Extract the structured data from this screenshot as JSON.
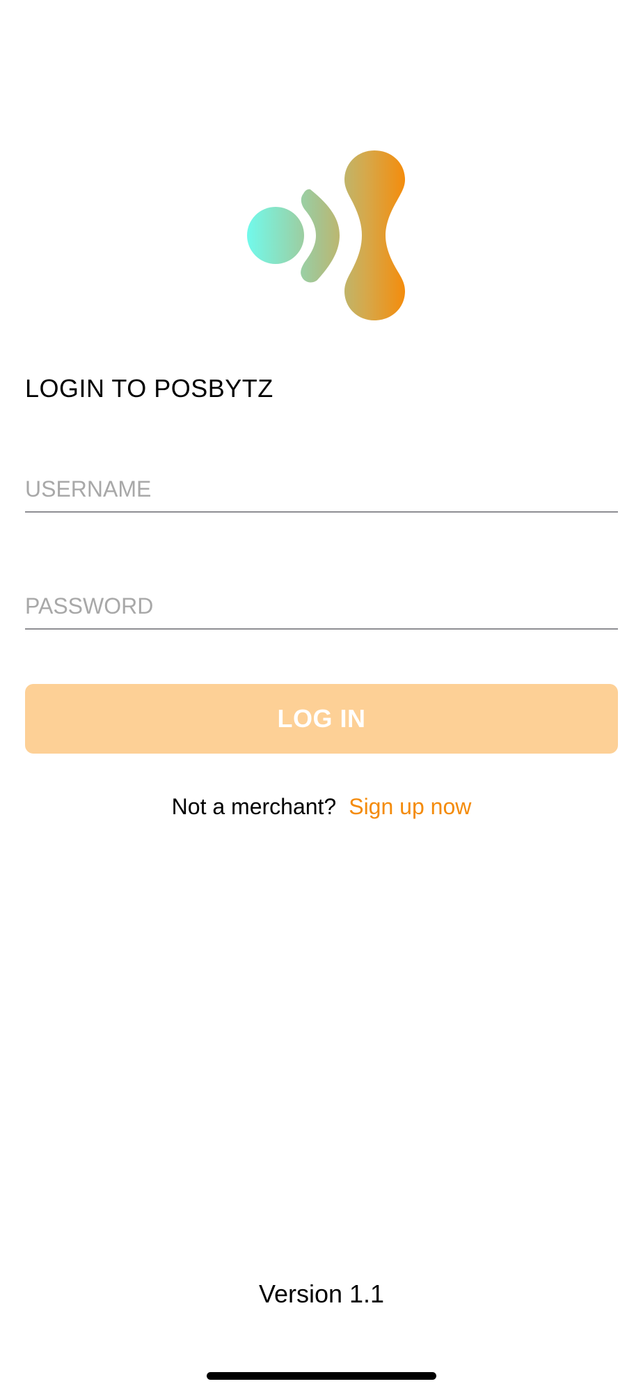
{
  "header": {
    "logo_icon": "posbytz-logo-icon",
    "title": "LOGIN TO POSBYTZ"
  },
  "form": {
    "username_placeholder": "USERNAME",
    "username_value": "",
    "password_placeholder": "PASSWORD",
    "password_value": "",
    "login_label": "LOG IN"
  },
  "signup": {
    "prompt": "Not a merchant?",
    "link_label": "Sign up now"
  },
  "footer": {
    "version": "Version 1.1"
  },
  "colors": {
    "accent": "#f48b0a",
    "button_disabled": "#fdd096",
    "logo_gradient_start": "#6ffcf0",
    "logo_gradient_end": "#f68a08",
    "input_underline": "#8e8e93",
    "placeholder": "#a8a8a8"
  }
}
